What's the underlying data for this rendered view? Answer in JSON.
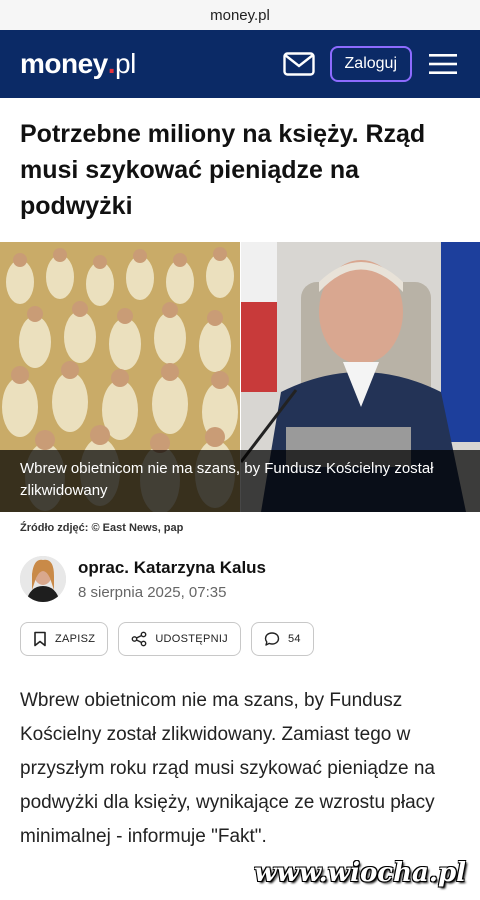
{
  "browser": {
    "url": "money.pl"
  },
  "header": {
    "logo_main": "money",
    "logo_dot": ".",
    "logo_tld": "pl",
    "login_label": "Zaloguj",
    "icons": [
      "mail-icon",
      "hamburger-menu-icon"
    ],
    "background_color": "#0b2a66",
    "accent_color": "#8d6bff"
  },
  "article": {
    "title": "Potrzebne miliony na księży. Rząd musi szykować pieniądze na podwyżki",
    "image_caption": "Wbrew obietnicom nie ma szans, by Fundusz Kościelny został zlikwidowany",
    "image_credit": "Źródło zdjęć: © East News, pap",
    "author": "oprac. Katarzyna Kalus",
    "date": "8 sierpnia 2025, 07:35",
    "actions": {
      "save_label": "ZAPISZ",
      "share_label": "UDOSTĘPNIJ",
      "comments_count": "54"
    },
    "lead": "Wbrew obietnicom nie ma szans, by Fundusz Kościelny został zlikwidowany. Zamiast tego w przyszłym roku rząd musi szykować pieniądze na podwyżki dla księży, wynikające ze wzrostu płacy minimalnej - informuje \"Fakt\"."
  },
  "watermark": "www.wiocha.pl"
}
